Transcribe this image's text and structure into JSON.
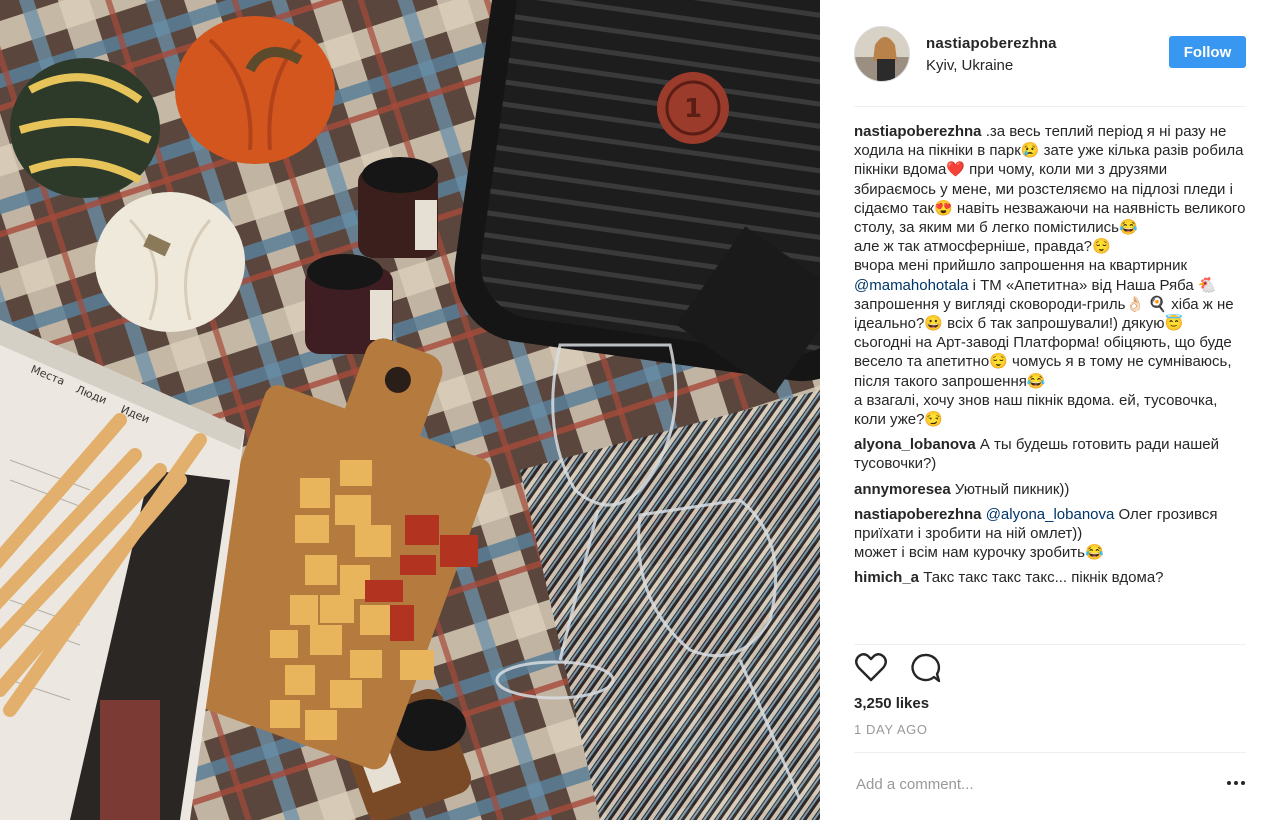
{
  "post": {
    "username": "nastiapoberezhna",
    "location": "Kyiv, Ukraine",
    "follow_label": "Follow",
    "likes": "3,250 likes",
    "time": "1 DAY AGO",
    "add_comment_placeholder": "Add a comment..."
  },
  "caption": {
    "username": "nastiapoberezhna",
    "text_1": " .за весь теплий період я ні разу не ходила на пікніки в парк😢 зате уже кілька разів робила пікніки вдома❤️ при чому, коли ми з друзями збираємось у мене, ми розстеляємо на підлозі пледи і сідаємо так😍 навіть незважаючи на наявність великого столу, за яким ми б легко помістились😂\nале ж так атмосферніше, правда?😌\nвчора мені прийшло запрошення на квартирник ",
    "mention": "@mamahohotala",
    "text_2": " і ТМ «Апетитна» від Наша Ряба 🐔 запрошення у вигляді сковороди-гриль👌🏻 🍳 хіба ж не ідеально?😀 всіх б так запрошували!) дякую😇\nсьогодні на Арт-заводі Платформа! обіцяють, що буде весело та апетитно😌 чомусь я в тому не сумніваюсь, після такого запрошення😂\nа взагалі, хочу знов наш пікнік вдома. ей, тусовочка, коли уже?😏"
  },
  "comments": [
    {
      "username": "alyona_lobanova",
      "mention": "",
      "text": " А ты будешь готовить ради нашей тусовочки?)"
    },
    {
      "username": "annymoresea",
      "mention": "",
      "text": " Уютный пикник))"
    },
    {
      "username": "nastiapoberezhna",
      "mention": "@alyona_lobanova",
      "text": " Олег грозився приїхати і зробити на ній омлет))\nможет і всім нам курочку зробить😂"
    },
    {
      "username": "himich_a",
      "mention": "",
      "text": " Такс такс такс такс... пікнік вдома?"
    }
  ],
  "colors": {
    "accent": "#3897f0",
    "mention": "#003569",
    "muted": "#999999"
  },
  "icons": [
    "heart-icon",
    "comment-icon",
    "more-options-icon"
  ]
}
